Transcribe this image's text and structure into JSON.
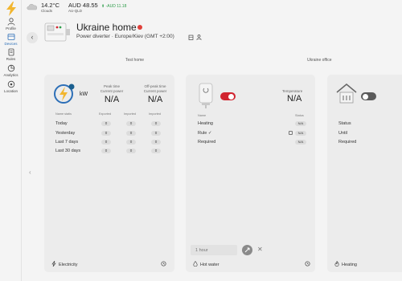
{
  "sidebar": {
    "items": [
      {
        "label": "Profile",
        "icon": "person-icon"
      },
      {
        "label": "Devices",
        "icon": "devices-icon",
        "active": true
      },
      {
        "label": "Rules",
        "icon": "rules-icon"
      },
      {
        "label": "Analytics",
        "icon": "analytics-icon"
      },
      {
        "label": "Location",
        "icon": "location-icon"
      }
    ]
  },
  "weather": {
    "temperature": "14.2°C",
    "condition": "Clouds"
  },
  "price": {
    "value": "AUD 48.55",
    "region": "AU-QLD",
    "change": "-AUD 11.18"
  },
  "home": {
    "title": "Ukraine home",
    "subtitle": "Power diverter · Europe/Kiev (GMT +2:00)"
  },
  "sections": {
    "left": "Test home",
    "right": "Ukraine office"
  },
  "electricity": {
    "unit": "kW",
    "peak_label_1": "Peak time",
    "peak_label_2": "Current power",
    "peak_value": "N/A",
    "offpeak_label_1": "Off-peak time",
    "offpeak_label_2": "Current power",
    "offpeak_value": "N/A",
    "col_name": "Name statis",
    "col_exported": "Exported",
    "col_imported": "Imported",
    "col_other": "Imported",
    "rows": [
      {
        "label": "Today",
        "v1": "0",
        "v2": "0",
        "v3": "0"
      },
      {
        "label": "Yesterday",
        "v1": "0",
        "v2": "0",
        "v3": "0"
      },
      {
        "label": "Last 7 days",
        "v1": "0",
        "v2": "0",
        "v3": "0"
      },
      {
        "label": "Last 30 days",
        "v1": "0",
        "v2": "0",
        "v3": "0"
      }
    ],
    "footer": "Electricity"
  },
  "hot_water": {
    "toggle_on": true,
    "temp_label": "Temperature",
    "temp_value": "N/A",
    "col_name": "Name",
    "col_status": "Status",
    "rows": [
      {
        "label": "Heating",
        "status": "N/A"
      },
      {
        "label": "Rule ✓",
        "status": "N/A"
      },
      {
        "label": "Required",
        "status": "N/A"
      }
    ],
    "hours_placeholder": "1 hour",
    "footer": "Hot water"
  },
  "heating": {
    "toggle_on": false,
    "rows": [
      "Status",
      "Until",
      "Required"
    ],
    "footer": "Heating"
  },
  "colors": {
    "accent": "#2d6fb7",
    "toggle_on": "#d1242f",
    "toggle_off": "#5a5a5a",
    "bolt": "#f2b630",
    "up": "#2e9d4a"
  }
}
